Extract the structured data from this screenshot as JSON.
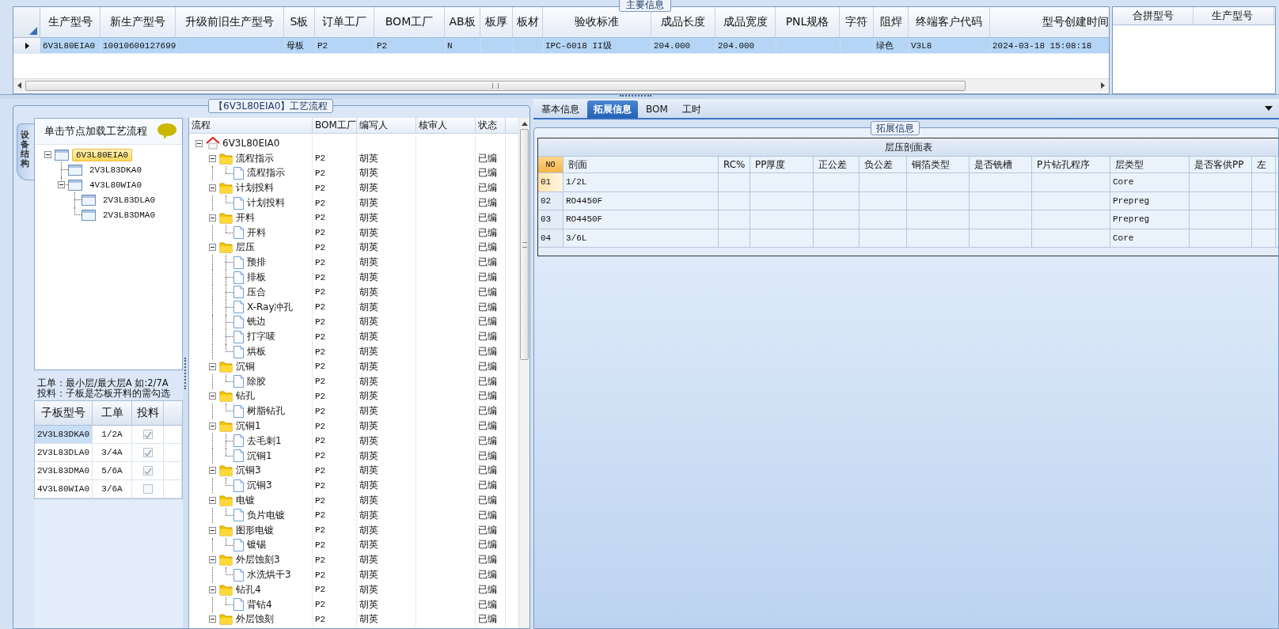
{
  "main_info": {
    "title": "主要信息",
    "columns": [
      "生产型号",
      "新生产型号",
      "升级前旧生产型号",
      "S板",
      "订单工厂",
      "BOM工厂",
      "AB板",
      "板厚",
      "板材",
      "验收标准",
      "成品长度",
      "成品宽度",
      "PNL规格",
      "字符",
      "阻焊",
      "终端客户代码",
      "型号创建时间"
    ],
    "rows": [
      {
        "selected": true,
        "cells": [
          "6V3L80EIA0",
          "10010600127699",
          "",
          "母板",
          "P2",
          "P2",
          "N",
          "",
          "",
          "IPC-6018 II级",
          "204.000",
          "204.000",
          "",
          "",
          "绿色",
          "V3L8",
          "2024-03-18 15:08:18"
        ]
      }
    ]
  },
  "merge_table": {
    "columns": [
      "合拼型号",
      "生产型号"
    ]
  },
  "process_panel": {
    "title": "【6V3L80EIA0】工艺流程"
  },
  "side_tab": {
    "label": "设备结构"
  },
  "board_tree": {
    "hint": "单击节点加载工艺流程",
    "nodes": [
      {
        "label": "6V3L80EIA0",
        "selected": true,
        "expanded": true,
        "children": [
          {
            "label": "2V3L83DKA0",
            "selected": false
          },
          {
            "label": "4V3L80WIA0",
            "selected": false,
            "expanded": true,
            "children": [
              {
                "label": "2V3L83DLA0",
                "selected": false
              },
              {
                "label": "2V3L83DMA0",
                "selected": false
              }
            ]
          }
        ]
      }
    ]
  },
  "notes": [
    "工单：最小层/最大层A 如:2/7A",
    "投料：子板是芯板开料的需勾选"
  ],
  "sub_boards": {
    "columns": [
      "子板型号",
      "工单",
      "投料"
    ],
    "rows": [
      {
        "model": "2V3L83DKA0",
        "order": "1/2A",
        "feed": true,
        "selected": true
      },
      {
        "model": "2V3L83DLA0",
        "order": "3/4A",
        "feed": true,
        "selected": false
      },
      {
        "model": "2V3L83DMA0",
        "order": "5/6A",
        "feed": true,
        "selected": false
      },
      {
        "model": "4V3L80WIA0",
        "order": "3/6A",
        "feed": false,
        "selected": false
      }
    ]
  },
  "process_flow": {
    "columns": [
      "流程",
      "BOM工厂",
      "编写人",
      "核审人",
      "状态"
    ],
    "nodes": [
      {
        "label": "6V3L80EIA0",
        "expanded": true,
        "children": [
          {
            "label": "流程指示",
            "factory": "P2",
            "writer": "胡英",
            "status": "已编",
            "expanded": true,
            "children": [
              {
                "label": "流程指示",
                "factory": "P2",
                "writer": "胡英",
                "status": "已编"
              }
            ]
          },
          {
            "label": "计划投料",
            "factory": "P2",
            "writer": "胡英",
            "status": "已编",
            "expanded": true,
            "children": [
              {
                "label": "计划投料",
                "factory": "P2",
                "writer": "胡英",
                "status": "已编"
              }
            ]
          },
          {
            "label": "开料",
            "factory": "P2",
            "writer": "胡英",
            "status": "已编",
            "expanded": true,
            "children": [
              {
                "label": "开料",
                "factory": "P2",
                "writer": "胡英",
                "status": "已编"
              }
            ]
          },
          {
            "label": "层压",
            "factory": "P2",
            "writer": "胡英",
            "status": "已编",
            "expanded": true,
            "children": [
              {
                "label": "预排",
                "factory": "P2",
                "writer": "胡英",
                "status": "已编"
              },
              {
                "label": "排板",
                "factory": "P2",
                "writer": "胡英",
                "status": "已编"
              },
              {
                "label": "压合",
                "factory": "P2",
                "writer": "胡英",
                "status": "已编"
              },
              {
                "label": "X-Ray冲孔",
                "factory": "P2",
                "writer": "胡英",
                "status": "已编"
              },
              {
                "label": "铣边",
                "factory": "P2",
                "writer": "胡英",
                "status": "已编"
              },
              {
                "label": "打字唛",
                "factory": "P2",
                "writer": "胡英",
                "status": "已编"
              },
              {
                "label": "烘板",
                "factory": "P2",
                "writer": "胡英",
                "status": "已编"
              }
            ]
          },
          {
            "label": "沉铜",
            "factory": "P2",
            "writer": "胡英",
            "status": "已编",
            "expanded": true,
            "children": [
              {
                "label": "除胶",
                "factory": "P2",
                "writer": "胡英",
                "status": "已编"
              }
            ]
          },
          {
            "label": "钻孔",
            "factory": "P2",
            "writer": "胡英",
            "status": "已编",
            "expanded": true,
            "children": [
              {
                "label": "树脂钻孔",
                "factory": "P2",
                "writer": "胡英",
                "status": "已编"
              }
            ]
          },
          {
            "label": "沉铜1",
            "factory": "P2",
            "writer": "胡英",
            "status": "已编",
            "expanded": true,
            "children": [
              {
                "label": "去毛刺1",
                "factory": "P2",
                "writer": "胡英",
                "status": "已编"
              },
              {
                "label": "沉铜1",
                "factory": "P2",
                "writer": "胡英",
                "status": "已编"
              }
            ]
          },
          {
            "label": "沉铜3",
            "factory": "P2",
            "writer": "胡英",
            "status": "已编",
            "expanded": true,
            "children": [
              {
                "label": "沉铜3",
                "factory": "P2",
                "writer": "胡英",
                "status": "已编"
              }
            ]
          },
          {
            "label": "电镀",
            "factory": "P2",
            "writer": "胡英",
            "status": "已编",
            "expanded": true,
            "children": [
              {
                "label": "负片电镀",
                "factory": "P2",
                "writer": "胡英",
                "status": "已编"
              }
            ]
          },
          {
            "label": "图形电镀",
            "factory": "P2",
            "writer": "胡英",
            "status": "已编",
            "expanded": true,
            "children": [
              {
                "label": "镀锡",
                "factory": "P2",
                "writer": "胡英",
                "status": "已编"
              }
            ]
          },
          {
            "label": "外层蚀刻3",
            "factory": "P2",
            "writer": "胡英",
            "status": "已编",
            "expanded": true,
            "children": [
              {
                "label": "水洗烘干3",
                "factory": "P2",
                "writer": "胡英",
                "status": "已编"
              }
            ]
          },
          {
            "label": "钻孔4",
            "factory": "P2",
            "writer": "胡英",
            "status": "已编",
            "expanded": true,
            "children": [
              {
                "label": "背钻4",
                "factory": "P2",
                "writer": "胡英",
                "status": "已编"
              }
            ]
          },
          {
            "label": "外层蚀刻",
            "factory": "P2",
            "writer": "胡英",
            "status": "已编",
            "expanded": true
          }
        ]
      }
    ]
  },
  "tabs": [
    {
      "label": "基本信息",
      "selected": false
    },
    {
      "label": "拓展信息",
      "selected": true
    },
    {
      "label": "BOM",
      "selected": false
    },
    {
      "label": "工时",
      "selected": false
    }
  ],
  "extended_info": {
    "title": "拓展信息",
    "table_title": "层压剖面表",
    "columns": [
      "NO",
      "剖面",
      "RC%",
      "PP厚度",
      "正公差",
      "负公差",
      "铜箔类型",
      "是否铣槽",
      "P片钻孔程序",
      "层类型",
      "是否客供PP",
      "左"
    ],
    "rows": [
      {
        "no": "01",
        "section": "1/2L",
        "layer_type": "Core",
        "selected": true
      },
      {
        "no": "02",
        "section": "RO4450F",
        "layer_type": "Prepreg",
        "selected": false
      },
      {
        "no": "03",
        "section": "RO4450F",
        "layer_type": "Prepreg",
        "selected": false
      },
      {
        "no": "04",
        "section": "3/6L",
        "layer_type": "Core",
        "selected": false
      }
    ]
  }
}
